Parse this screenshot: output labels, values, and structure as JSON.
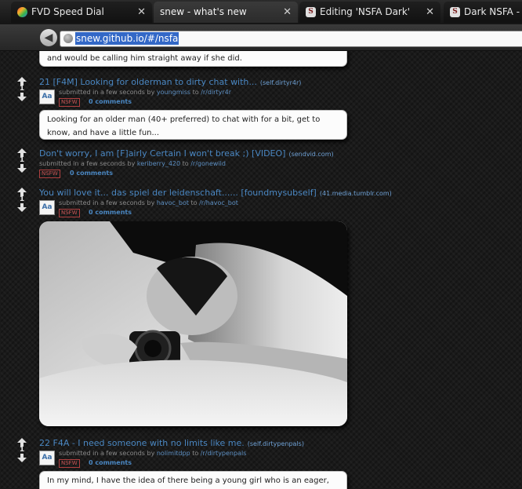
{
  "tabs": [
    {
      "title": "FVD Speed Dial",
      "close": "✕",
      "favicon": "fvd-speed-dial-icon"
    },
    {
      "title": "snew - what's new",
      "close": "✕",
      "favicon": "none"
    },
    {
      "title": "Editing 'NSFA Dark'",
      "close": "✕",
      "favicon": "s-icon",
      "favicon_letter": "S"
    },
    {
      "title": "Dark NSFA - The",
      "close": "",
      "favicon": "s-icon",
      "favicon_letter": "S"
    }
  ],
  "toolbar": {
    "back_icon": "arrow-left-icon",
    "back_glyph": "◀",
    "address": "snew.github.io/#/nsfa",
    "address_selected": true
  },
  "colors": {
    "link": "#4a87c2",
    "nsfw": "#c85454",
    "selection": "#3368c7",
    "page_bg": "#1a1a1a"
  },
  "top_snippet": {
    "text": "and would be calling him straight away if she did."
  },
  "posts": [
    {
      "rank": "21",
      "score": "1",
      "title": "21 [F4M] Looking for olderman to dirty chat with...",
      "domain": "(self.dirtyr4r)",
      "submitted": "submitted in a few seconds by",
      "author": "youngmiss",
      "to": "to",
      "subreddit": "/r/dirtyr4r",
      "nsfw": "NSFW",
      "comments": "0 comments",
      "thumb": "Aa",
      "selftext": "Looking for an older man (40+ preferred) to chat with for a bit, get to know, and have a little fun..."
    },
    {
      "score": "1",
      "title": "Don't worry, I am [F]airly Certain I won't break ;) [VIDEO]",
      "domain": "(sendvid.com)",
      "submitted": "submitted in a few seconds by",
      "author": "keriberry_420",
      "to": "to",
      "subreddit": "/r/gonewild",
      "nsfw": "NSFW",
      "comments": "0 comments"
    },
    {
      "score": "1",
      "title": "You will love it... das spiel der leidenschaft...... [foundmysubself]",
      "domain": "(41.media.tumblr.com)",
      "submitted": "submitted in a few seconds by",
      "author": "havoc_bot",
      "to": "to",
      "subreddit": "/r/havoc_bot",
      "nsfw": "NSFW",
      "comments": "0 comments",
      "thumb": "Aa"
    },
    {
      "score": "1",
      "title": "22 F4A - I need someone with no limits like me.",
      "domain": "(self.dirtypenpals)",
      "submitted": "submitted in a few seconds by",
      "author": "nolimitdpp",
      "to": "to",
      "subreddit": "/r/dirtypenpals",
      "nsfw": "NSFW",
      "comments": "0 comments",
      "thumb": "Aa",
      "selftext": "In my mind, I have the idea of there being a young girl who is an eager, willing"
    }
  ]
}
